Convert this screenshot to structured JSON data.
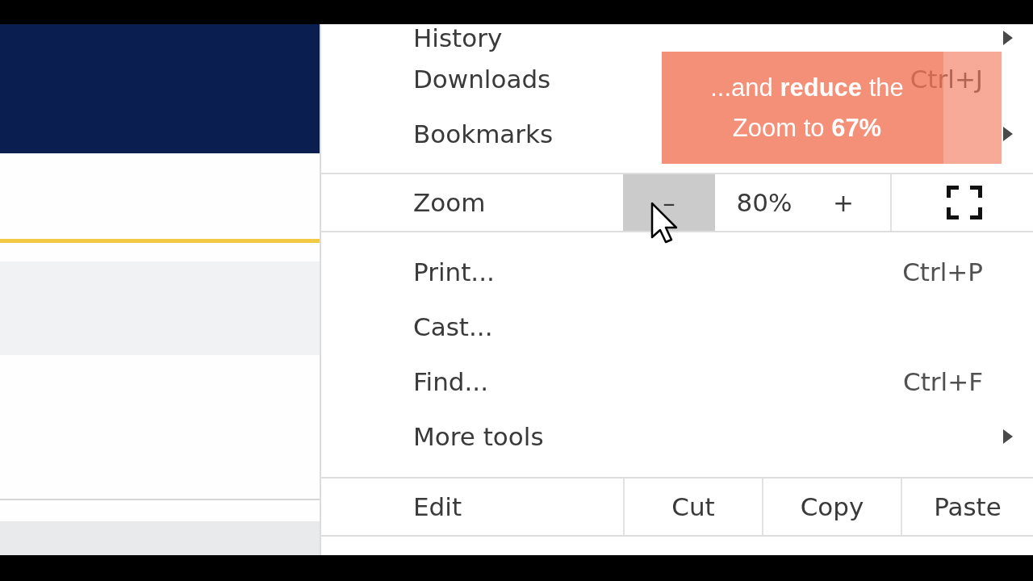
{
  "menu": {
    "sections": [
      {
        "items": [
          {
            "kind": "submenu",
            "label": "History"
          },
          {
            "kind": "command",
            "label": "Downloads",
            "shortcut": "Ctrl+J"
          },
          {
            "kind": "submenu",
            "label": "Bookmarks"
          }
        ]
      },
      {
        "items": [
          {
            "kind": "zoom",
            "label": "Zoom",
            "zoom_out": {
              "label": "–",
              "hovered": true
            },
            "level_text": "80%",
            "zoom_in": {
              "label": "+",
              "hovered": false
            }
          }
        ]
      },
      {
        "items": [
          {
            "kind": "command",
            "label": "Print...",
            "shortcut": "Ctrl+P"
          },
          {
            "kind": "command",
            "label": "Cast..."
          },
          {
            "kind": "command",
            "label": "Find...",
            "shortcut": "Ctrl+F"
          },
          {
            "kind": "submenu",
            "label": "More tools"
          }
        ]
      },
      {
        "items": [
          {
            "kind": "edit",
            "label": "Edit",
            "buttons": [
              {
                "label": "Cut"
              },
              {
                "label": "Copy"
              },
              {
                "label": "Paste"
              }
            ]
          }
        ]
      }
    ]
  },
  "callout": {
    "text": "...and **reduce** the Zoom to **67%**"
  }
}
